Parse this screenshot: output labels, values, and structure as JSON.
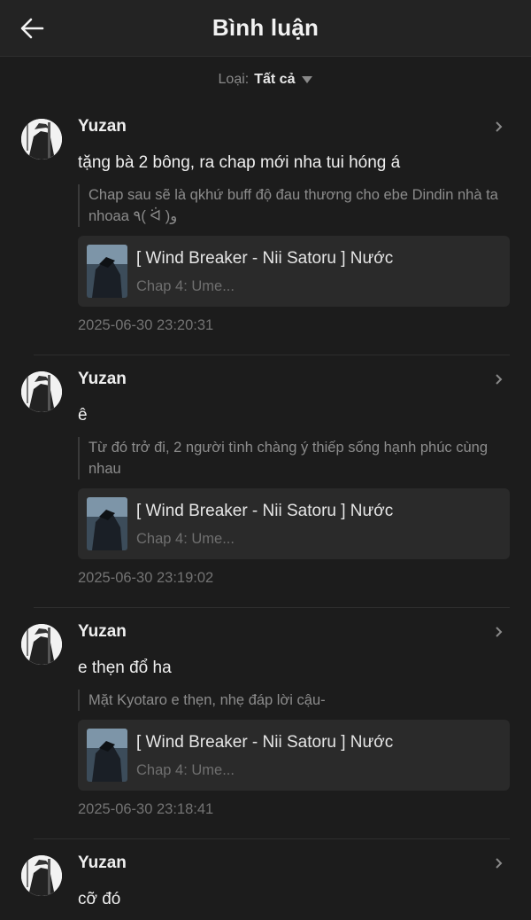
{
  "header": {
    "title": "Bình luận"
  },
  "filter": {
    "label": "Loại:",
    "value": "Tất cả"
  },
  "comments": [
    {
      "username": "Yuzan",
      "text": "tặng bà 2 bông, ra chap mới nha tui hóng á",
      "quote": "Chap sau sẽ là qkhứ buff độ đau thương cho ebe Dindin nhà ta nhoaa ٩( ᐛ )و",
      "story_title": "[ Wind Breaker - Nii Satoru ] Nước",
      "story_chapter": "Chap 4: Ume...",
      "time": "2025-06-30 23:20:31"
    },
    {
      "username": "Yuzan",
      "text": "ê",
      "quote": "Từ đó trở đi, 2 người tình chàng ý thiếp sống hạnh phúc cùng nhau",
      "story_title": "[ Wind Breaker - Nii Satoru ] Nước",
      "story_chapter": "Chap 4: Ume...",
      "time": "2025-06-30 23:19:02"
    },
    {
      "username": "Yuzan",
      "text": "e thẹn đổ ha",
      "quote": "Mặt Kyotaro e thẹn, nhẹ đáp lời cậu-",
      "story_title": "[ Wind Breaker - Nii Satoru ] Nước",
      "story_chapter": "Chap 4: Ume...",
      "time": "2025-06-30 23:18:41"
    },
    {
      "username": "Yuzan",
      "text": "cỡ đó"
    }
  ]
}
